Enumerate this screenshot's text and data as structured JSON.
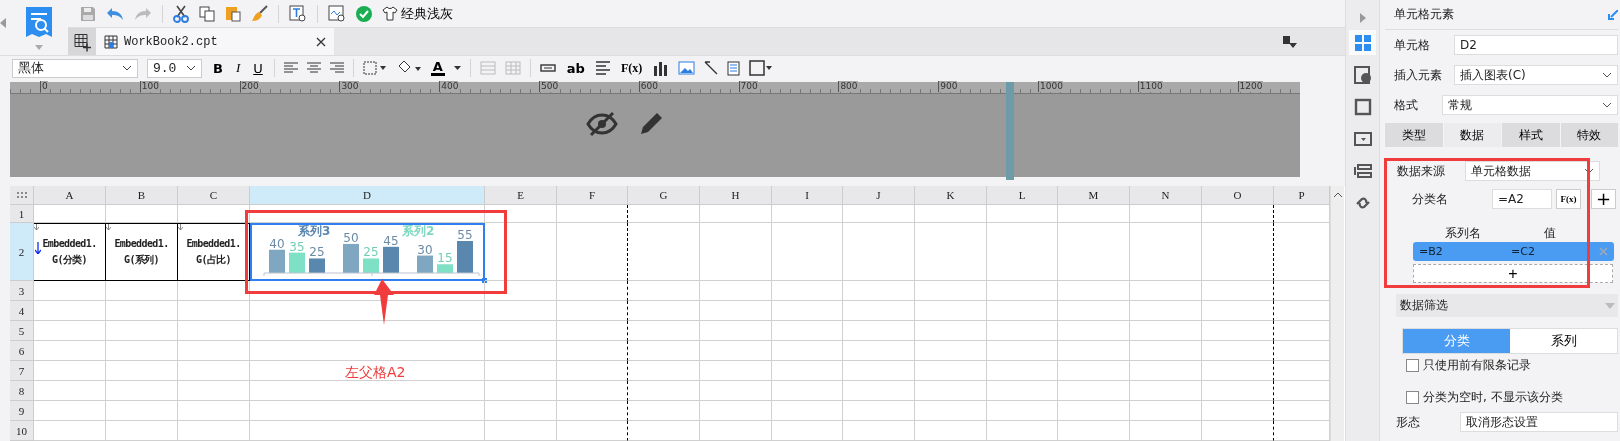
{
  "toolbar": {
    "theme_button": "经典浅灰"
  },
  "tabs": [
    {
      "label": "WorkBook2.cpt",
      "selected": true
    }
  ],
  "format_bar": {
    "font": "黑体",
    "size": "9.0",
    "bold": "B",
    "italic": "I",
    "underline": "U",
    "font_color": "A",
    "text_button": "ab",
    "formula_button": "F(x)"
  },
  "ruler": {
    "ticks": [
      "0",
      "100",
      "200",
      "300",
      "400",
      "500",
      "600",
      "700",
      "800",
      "900",
      "1000",
      "1100",
      "1200"
    ]
  },
  "sheet": {
    "columns": [
      {
        "label": "A",
        "selected": false
      },
      {
        "label": "B",
        "selected": false
      },
      {
        "label": "C",
        "selected": false
      },
      {
        "label": "D",
        "selected": true
      },
      {
        "label": "E",
        "selected": false
      },
      {
        "label": "F",
        "selected": false
      },
      {
        "label": "G",
        "selected": false
      },
      {
        "label": "H",
        "selected": false
      },
      {
        "label": "I",
        "selected": false
      },
      {
        "label": "J",
        "selected": false
      },
      {
        "label": "K",
        "selected": false
      },
      {
        "label": "L",
        "selected": false
      },
      {
        "label": "M",
        "selected": false
      },
      {
        "label": "N",
        "selected": false
      },
      {
        "label": "O",
        "selected": false
      },
      {
        "label": "P",
        "selected": false
      }
    ],
    "rows": [
      {
        "label": "1",
        "selected": false
      },
      {
        "label": "2",
        "selected": true
      },
      {
        "label": "3",
        "selected": false
      },
      {
        "label": "4",
        "selected": false
      },
      {
        "label": "5",
        "selected": false
      },
      {
        "label": "6",
        "selected": false
      },
      {
        "label": "7",
        "selected": false
      },
      {
        "label": "8",
        "selected": false
      },
      {
        "label": "9",
        "selected": false
      },
      {
        "label": "10",
        "selected": false
      }
    ],
    "cells": [
      {
        "text": "Embedded1.\nG(分类)"
      },
      {
        "text": "Embedded1.\nG(系列)"
      },
      {
        "text": "Embedded1.\nG(占比)"
      }
    ],
    "chart": {
      "chart_data": {
        "type": "bar",
        "data_labels": true,
        "series": [
          {
            "color": "#7fa7c1",
            "values": [
              40,
              50,
              30
            ]
          },
          {
            "color": "#7ee0c4",
            "values": [
              35,
              25,
              15
            ]
          },
          {
            "color": "#5a87ae",
            "values": [
              25,
              45,
              55
            ]
          }
        ],
        "annotations": [
          "系列3",
          "系列2"
        ]
      }
    }
  },
  "annotation": {
    "label": "左父格A2"
  },
  "side_icons": [
    {
      "selected": true
    },
    {
      "selected": false
    },
    {
      "selected": false
    },
    {
      "selected": false
    },
    {
      "selected": false
    },
    {
      "selected": false
    }
  ],
  "panel": {
    "title": "单元格元素",
    "cell_label": "单元格",
    "cell_value": "D2",
    "insert_label": "插入元素",
    "insert_value": "插入图表(C)",
    "format_label": "格式",
    "format_value": "常规",
    "tabs": [
      {
        "label": "类型",
        "selected": false
      },
      {
        "label": "数据",
        "selected": true
      },
      {
        "label": "样式",
        "selected": false
      },
      {
        "label": "特效",
        "selected": false
      }
    ],
    "source_label": "数据来源",
    "source_value": "单元格数据",
    "category_label": "分类名",
    "category_value": "=A2",
    "formula_button": "F(x)",
    "add_button": "+",
    "series_header": "系列名",
    "value_header": "值",
    "series_rows": [
      {
        "name": "=B2",
        "value": "=C2",
        "selected": true
      }
    ],
    "add_row": "+",
    "filter_title": "数据筛选",
    "filter_tabs": [
      {
        "label": "分类",
        "selected": true
      },
      {
        "label": "系列",
        "selected": false
      }
    ],
    "options": [
      {
        "label": "只使用前有限条记录",
        "checked": false
      },
      {
        "label": "分类为空时, 不显示该分类",
        "checked": false
      }
    ],
    "shape_label": "形态",
    "shape_value": "取消形态设置"
  }
}
